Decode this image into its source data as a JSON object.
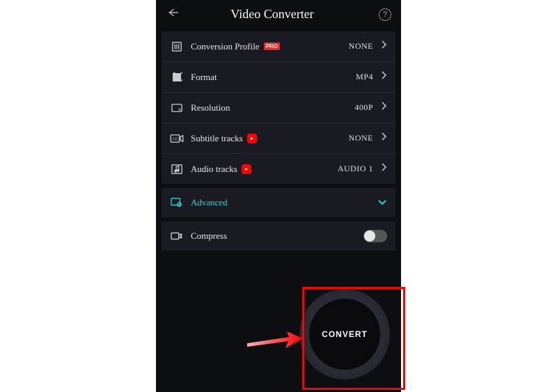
{
  "header": {
    "title": "Video Converter"
  },
  "rows": {
    "profile": {
      "label": "Conversion Profile",
      "badge": "PRO",
      "value": "NONE"
    },
    "format": {
      "label": "Format",
      "value": "MP4"
    },
    "resolution": {
      "label": "Resolution",
      "value": "400P"
    },
    "subtitle": {
      "label": "Subtitle tracks",
      "value": "NONE"
    },
    "audio": {
      "label": "Audio tracks",
      "value": "AUDIO 1"
    }
  },
  "advanced": {
    "label": "Advanced"
  },
  "compress": {
    "label": "Compress"
  },
  "convert": {
    "label": "CONVERT"
  }
}
